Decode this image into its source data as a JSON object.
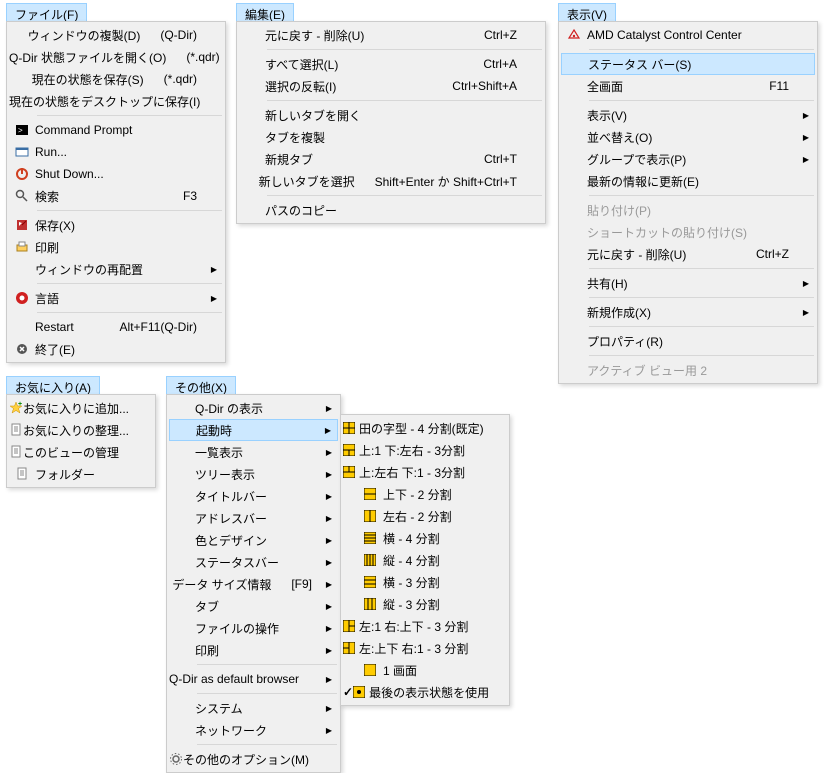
{
  "menus": {
    "file": {
      "title": "ファイル(F)",
      "items": [
        {
          "label": "ウィンドウの複製(D)",
          "shortcut": "(Q-Dir)",
          "icon": ""
        },
        {
          "label": "Q-Dir 状態ファイルを開く(O)",
          "shortcut": "(*.qdr)",
          "icon": ""
        },
        {
          "label": "現在の状態を保存(S)",
          "shortcut": "(*.qdr)",
          "icon": ""
        },
        {
          "label": "現在の状態をデスクトップに保存(I)",
          "shortcut": "",
          "icon": ""
        },
        {
          "sep": true
        },
        {
          "label": "Command Prompt",
          "icon": "cmd"
        },
        {
          "label": "Run...",
          "icon": "run"
        },
        {
          "label": "Shut Down...",
          "icon": "shutdown"
        },
        {
          "label": "検索",
          "shortcut": "F3",
          "icon": "search"
        },
        {
          "sep": true
        },
        {
          "label": "保存(X)",
          "icon": "save"
        },
        {
          "label": "印刷",
          "icon": "print"
        },
        {
          "label": "ウィンドウの再配置",
          "arrow": true
        },
        {
          "sep": true
        },
        {
          "label": "言語",
          "arrow": true,
          "icon": "lang"
        },
        {
          "sep": true
        },
        {
          "label": "Restart",
          "shortcut": "Alt+F11(Q-Dir)"
        },
        {
          "label": "終了(E)",
          "icon": "exit"
        }
      ]
    },
    "edit": {
      "title": "編集(E)",
      "items": [
        {
          "label": "元に戻す - 削除(U)",
          "shortcut": "Ctrl+Z"
        },
        {
          "sep": true
        },
        {
          "label": "すべて選択(L)",
          "shortcut": "Ctrl+A"
        },
        {
          "label": "選択の反転(I)",
          "shortcut": "Ctrl+Shift+A"
        },
        {
          "sep": true
        },
        {
          "label": "新しいタブを開く"
        },
        {
          "label": "タブを複製"
        },
        {
          "label": "新規タブ",
          "shortcut": "Ctrl+T"
        },
        {
          "label": "新しいタブを選択",
          "shortcut": "Shift+Enter か Shift+Ctrl+T"
        },
        {
          "sep": true
        },
        {
          "label": "パスのコピー"
        }
      ]
    },
    "view": {
      "title": "表示(V)",
      "items": [
        {
          "label": "AMD Catalyst Control Center",
          "icon": "amd"
        },
        {
          "sep": true
        },
        {
          "label": "ステータス バー(S)",
          "hover": true
        },
        {
          "label": "全画面",
          "shortcut": "F11"
        },
        {
          "sep": true
        },
        {
          "label": "表示(V)",
          "arrow": true
        },
        {
          "label": "並べ替え(O)",
          "arrow": true
        },
        {
          "label": "グループで表示(P)",
          "arrow": true
        },
        {
          "label": "最新の情報に更新(E)"
        },
        {
          "sep": true
        },
        {
          "label": "貼り付け(P)",
          "disabled": true
        },
        {
          "label": "ショートカットの貼り付け(S)",
          "disabled": true
        },
        {
          "label": "元に戻す - 削除(U)",
          "shortcut": "Ctrl+Z"
        },
        {
          "sep": true
        },
        {
          "label": "共有(H)",
          "arrow": true
        },
        {
          "sep": true
        },
        {
          "label": "新規作成(X)",
          "arrow": true
        },
        {
          "sep": true
        },
        {
          "label": "プロパティ(R)"
        },
        {
          "sep": true
        },
        {
          "label": "アクティブ ビュー用 2",
          "disabled": true
        }
      ]
    },
    "fav": {
      "title": "お気に入り(A)",
      "items": [
        {
          "label": "お気に入りに追加...",
          "icon": "favadd"
        },
        {
          "label": "お気に入りの整理...",
          "icon": "doc"
        },
        {
          "label": "このビューの管理",
          "icon": "doc"
        },
        {
          "label": "フォルダー",
          "icon": "doc"
        }
      ]
    },
    "other": {
      "title": "その他(X)",
      "items": [
        {
          "label": "Q-Dir の表示",
          "arrow": true
        },
        {
          "label": "起動時",
          "arrow": true,
          "hover": true
        },
        {
          "label": "一覧表示",
          "arrow": true
        },
        {
          "label": "ツリー表示",
          "arrow": true
        },
        {
          "label": "タイトルバー",
          "arrow": true
        },
        {
          "label": "アドレスバー",
          "arrow": true
        },
        {
          "label": "色とデザイン",
          "arrow": true
        },
        {
          "label": "ステータスバー",
          "arrow": true
        },
        {
          "label": "データ サイズ情報",
          "shortcut": "[F9]",
          "arrow": true
        },
        {
          "label": "タブ",
          "arrow": true
        },
        {
          "label": "ファイルの操作",
          "arrow": true
        },
        {
          "label": "印刷",
          "arrow": true
        },
        {
          "sep": true
        },
        {
          "label": "Q-Dir as default browser",
          "arrow": true
        },
        {
          "sep": true
        },
        {
          "label": "システム",
          "arrow": true
        },
        {
          "label": "ネットワーク",
          "arrow": true
        },
        {
          "sep": true
        },
        {
          "label": "その他のオプション(M)",
          "icon": "gear"
        }
      ]
    },
    "startup_sub": {
      "items": [
        {
          "label": "田の字型 - 4 分割(既定)",
          "gi": "g4"
        },
        {
          "label": "上:1 下:左右 - 3分割",
          "gi": "g3a"
        },
        {
          "label": "上:左右 下:1 - 3分割",
          "gi": "g3b"
        },
        {
          "label": "上下 - 2 分割",
          "gi": "g2v"
        },
        {
          "label": "左右 - 2 分割",
          "gi": "g2h"
        },
        {
          "label": "横 - 4 分割",
          "gi": "g4h"
        },
        {
          "label": "縦 - 4 分割",
          "gi": "g4v"
        },
        {
          "label": "横 - 3 分割",
          "gi": "g3h"
        },
        {
          "label": "縦 - 3 分割",
          "gi": "g3v"
        },
        {
          "label": "左:1 右:上下 - 3 分割",
          "gi": "g3c"
        },
        {
          "label": "左:上下 右:1 - 3 分割",
          "gi": "g3d"
        },
        {
          "label": "1 画面",
          "gi": "g1"
        },
        {
          "label": "最後の表示状態を使用",
          "gi": "gs",
          "checked": true
        }
      ]
    }
  }
}
